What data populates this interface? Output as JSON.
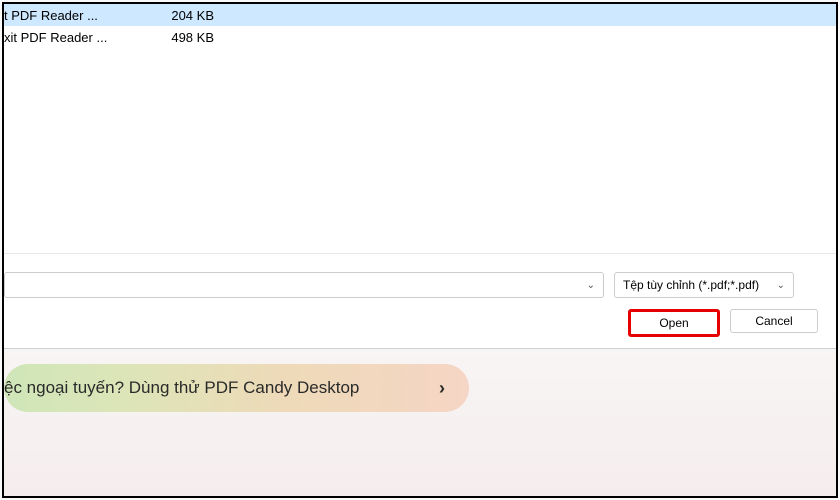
{
  "files": [
    {
      "name": "t PDF Reader ...",
      "size": "204 KB",
      "selected": true
    },
    {
      "name": "xit PDF Reader ...",
      "size": "498 KB",
      "selected": false
    }
  ],
  "filter": {
    "selected": "Tệp tùy chỉnh (*.pdf;*.pdf)"
  },
  "buttons": {
    "open": "Open",
    "cancel": "Cancel"
  },
  "banner": {
    "text": "ệc ngoại tuyến? Dùng thử PDF Candy Desktop"
  }
}
